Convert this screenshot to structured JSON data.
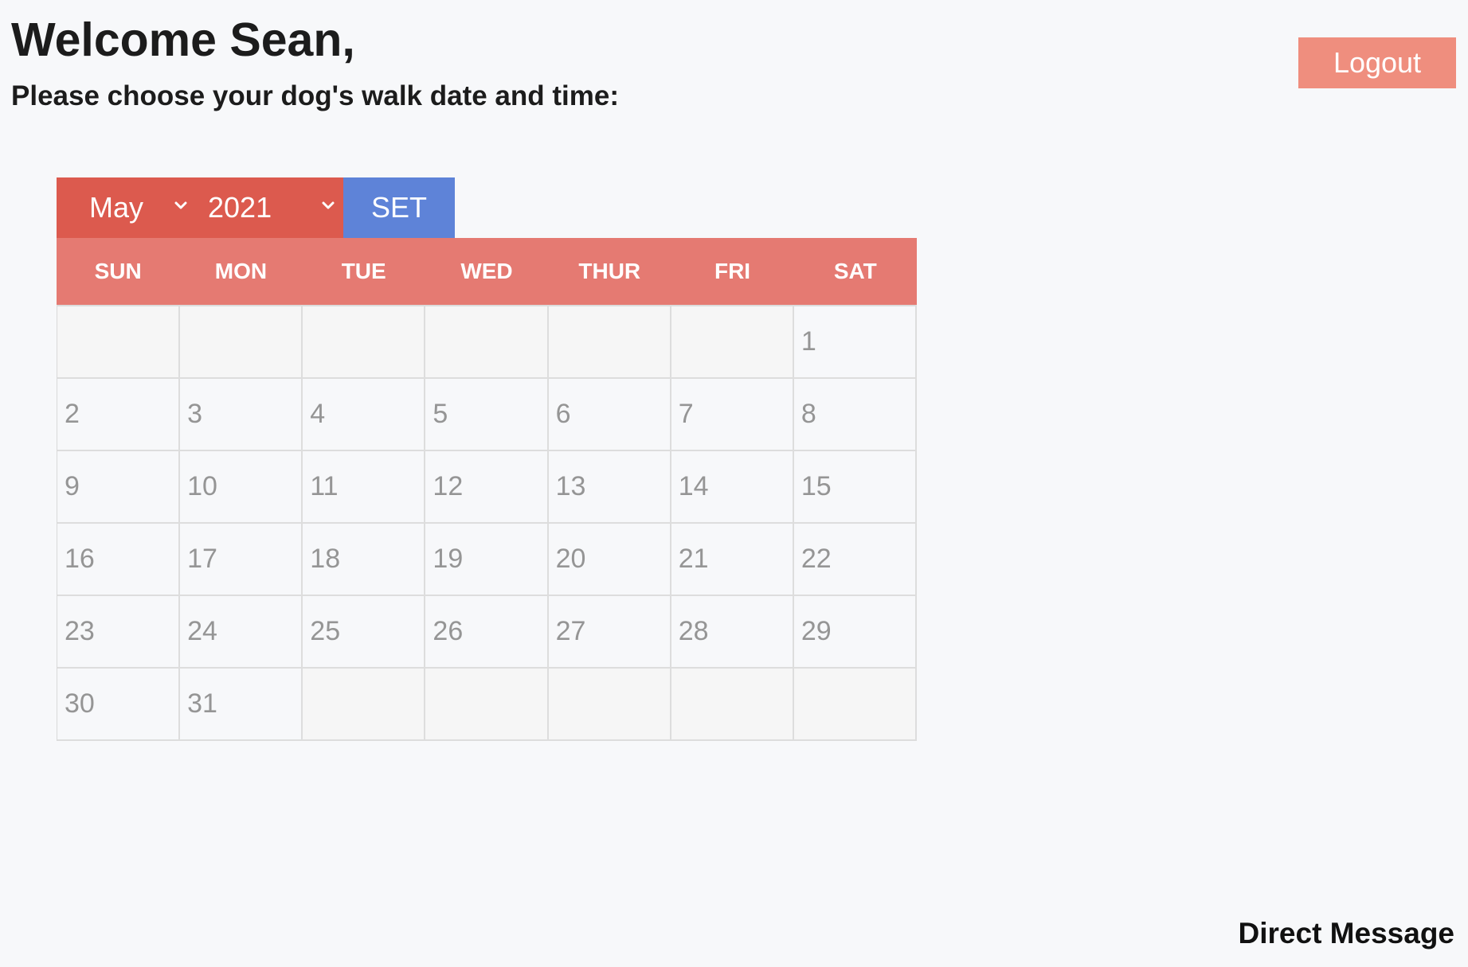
{
  "header": {
    "welcome": "Welcome Sean,",
    "subtitle": "Please choose your dog's walk date and time:"
  },
  "logout_label": "Logout",
  "controls": {
    "month": "May",
    "year": "2021",
    "set_label": "SET"
  },
  "weekdays": [
    "SUN",
    "MON",
    "TUE",
    "WED",
    "THUR",
    "FRI",
    "SAT"
  ],
  "days": [
    "",
    "",
    "",
    "",
    "",
    "",
    "1",
    "2",
    "3",
    "4",
    "5",
    "6",
    "7",
    "8",
    "9",
    "10",
    "11",
    "12",
    "13",
    "14",
    "15",
    "16",
    "17",
    "18",
    "19",
    "20",
    "21",
    "22",
    "23",
    "24",
    "25",
    "26",
    "27",
    "28",
    "29",
    "30",
    "31",
    "",
    "",
    "",
    "",
    ""
  ],
  "footer": {
    "direct_message": "Direct Message"
  },
  "colors": {
    "background": "#f7f8fa",
    "logout": "#ef8e7e",
    "selects": "#dc5a4e",
    "set_button": "#5e83d8",
    "weekday_header": "#e57a72"
  },
  "icons": {
    "dropdown": "chevron-down-icon"
  }
}
